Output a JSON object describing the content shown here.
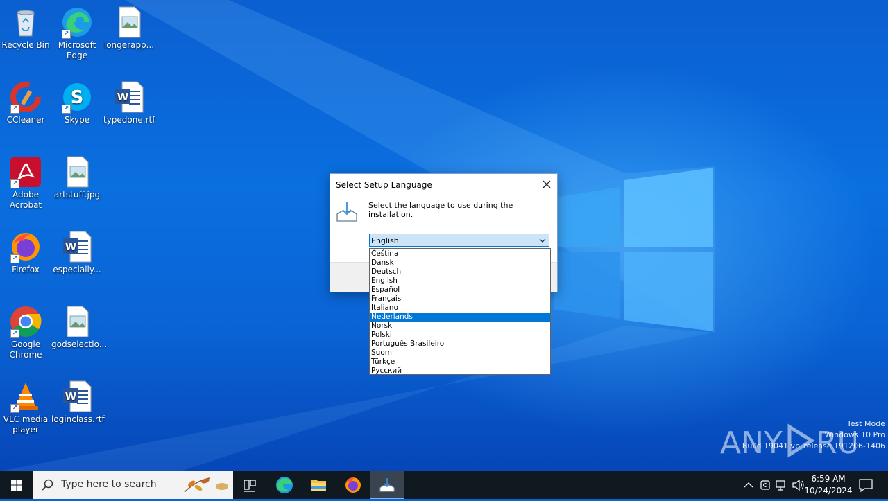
{
  "desktop": {
    "icons": [
      {
        "label": "Recycle Bin",
        "icon": "recycle-bin-icon"
      },
      {
        "label": "Microsoft Edge",
        "icon": "edge-icon"
      },
      {
        "label": "longerapp...",
        "icon": "image-file-icon"
      },
      {
        "label": "CCleaner",
        "icon": "ccleaner-icon"
      },
      {
        "label": "Skype",
        "icon": "skype-icon"
      },
      {
        "label": "typedone.rtf",
        "icon": "word-document-icon"
      },
      {
        "label": "Adobe Acrobat",
        "icon": "acrobat-icon"
      },
      {
        "label": "artstuff.jpg",
        "icon": "image-file-icon"
      },
      {
        "label": "Firefox",
        "icon": "firefox-icon"
      },
      {
        "label": "especially...",
        "icon": "word-document-icon"
      },
      {
        "label": "Google Chrome",
        "icon": "chrome-icon"
      },
      {
        "label": "godselectio...",
        "icon": "image-file-icon"
      },
      {
        "label": "VLC media player",
        "icon": "vlc-icon"
      },
      {
        "label": "loginclass.rtf",
        "icon": "word-document-icon"
      }
    ]
  },
  "dialog": {
    "title": "Select Setup Language",
    "prompt": "Select the language to use during the installation.",
    "selected_value": "English",
    "options": [
      "Čeština",
      "Dansk",
      "Deutsch",
      "English",
      "Español",
      "Français",
      "Italiano",
      "Nederlands",
      "Norsk",
      "Polski",
      "Português Brasileiro",
      "Suomi",
      "Türkçe",
      "Русский"
    ],
    "highlighted_option": "Nederlands"
  },
  "watermark": {
    "line1": "Test Mode",
    "line2": "Windows 10 Pro",
    "line3": "Build 19041.vb_release.191206-1406",
    "logo": "ANY RUN"
  },
  "taskbar": {
    "search_placeholder": "Type here to search",
    "time": "6:59 AM",
    "date": "10/24/2024"
  },
  "colors": {
    "accent": "#0078d7",
    "taskbar": "#101820",
    "desktop": "#0a64d6"
  }
}
